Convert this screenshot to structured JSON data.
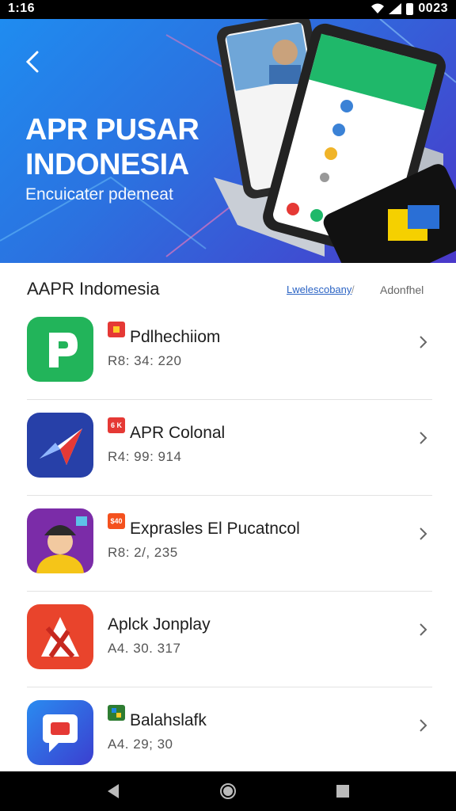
{
  "status_bar": {
    "time": "1:16",
    "clock": "0023"
  },
  "hero": {
    "title": "APR PUSAR INDONESIA",
    "subtitle": "Encuicater pdemeat",
    "colors": {
      "start": "#1f8cf0",
      "end": "#4a38c9"
    }
  },
  "section": {
    "title": "AAPR Indomesia",
    "link": "Lwelescobany",
    "separator": "/",
    "link2": "Adonfhel"
  },
  "apps": [
    {
      "name": "Pdlhechiiom",
      "meta": "R8: 34: 220",
      "badge": "",
      "icon": "green-p-icon",
      "badge_color": "#e53935"
    },
    {
      "name": "APR Colonal",
      "meta": "R4: 99: 914",
      "badge": "6 K",
      "icon": "blue-arrow-icon",
      "badge_color": "#e53935"
    },
    {
      "name": "Exprasles El Pucatncol",
      "meta": "R8: 2/, 235",
      "badge": "$40",
      "icon": "avatar-icon",
      "badge_color": "#f4511e"
    },
    {
      "name": "Aplck Jonplay",
      "meta": "A4. 30. 317",
      "badge": "",
      "icon": "red-x-icon",
      "badge_color": ""
    },
    {
      "name": "Balahslafk",
      "meta": "A4. 29; 30",
      "badge": "",
      "icon": "chat-icon",
      "badge_color": "#2e7d32"
    }
  ]
}
